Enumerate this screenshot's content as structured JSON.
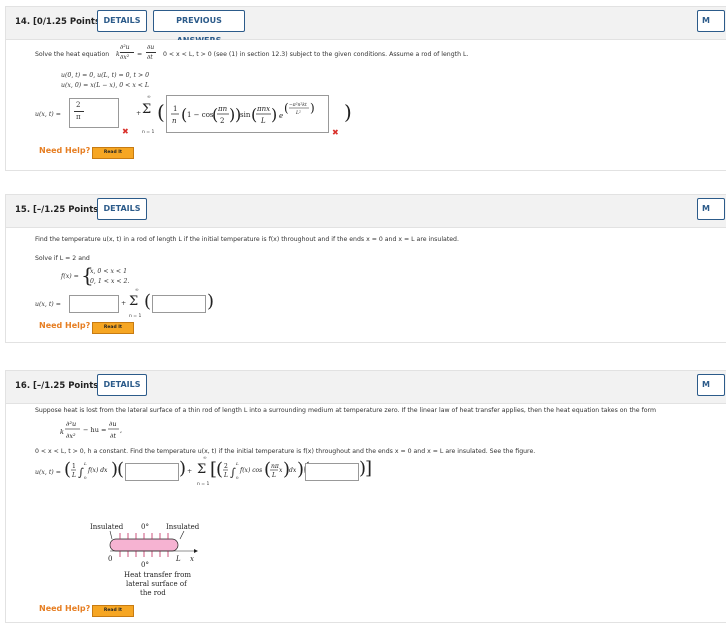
{
  "q14": {
    "number": "14.",
    "points": "[0/1.25 Points]",
    "details": "DETAILS",
    "previous": "PREVIOUS ANSWERS",
    "more": "M",
    "prompt_pre": "Solve the heat equation",
    "prompt_post": "0 < x < L,  t > 0 (see (1) in section 12.3) subject to the given conditions. Assume a rod of length L.",
    "heat_lhs": "k",
    "cond1": "u(0, t) = 0,  u(L, t) = 0,  t > 0",
    "cond2": "u(x, 0) = x(L − x),  0 < x < L",
    "u_label": "u(x, t) =",
    "answer1_num": "2",
    "answer1_den": "π",
    "sum_top": "∞",
    "sum_bottom": "n = 1",
    "help": "Need Help?",
    "readit": "Read It"
  },
  "q15": {
    "number": "15.",
    "points": "[–/1.25 Points]",
    "details": "DETAILS",
    "more": "M",
    "prompt": "Find the temperature u(x, t) in a rod of length L if the initial temperature is f(x) throughout and if the ends x = 0 and x = L are insulated.",
    "solve_if": "Solve if L = 2 and",
    "fx": "f(x) =",
    "case1": "x,   0 < x < 1",
    "case2": "0,   1 < x < 2.",
    "u_label": "u(x, t) =",
    "plus": "+",
    "sum_top": "∞",
    "sum_bottom": "n = 1",
    "help": "Need Help?",
    "readit": "Read It"
  },
  "q16": {
    "number": "16.",
    "points": "[–/1.25 Points]",
    "details": "DETAILS",
    "more": "M",
    "prompt": "Suppose heat is lost from the lateral surface of a thin rod of length L into a surrounding medium at temperature zero. If the linear law of heat transfer applies, then the heat equation takes on the form",
    "cond": "0 < x < L, t > 0, h a constant. Find the temperature u(x, t) if the initial temperature is f(x) throughout and the ends x = 0 and x = L are insulated. See the figure.",
    "u_label": "u(x, t) =",
    "sum_top": "∞",
    "sum_bottom": "n = 1",
    "fig_insulated_left": "Insulated",
    "fig_zero_top": "0°",
    "fig_insulated_right": "Insulated",
    "fig_zero_axis": "0",
    "fig_L": "L",
    "fig_x": "x",
    "fig_zero_bottom": "0°",
    "fig_caption1": "Heat transfer from",
    "fig_caption2": "lateral surface of",
    "fig_caption3": "the rod",
    "help": "Need Help?",
    "readit": "Read It"
  }
}
